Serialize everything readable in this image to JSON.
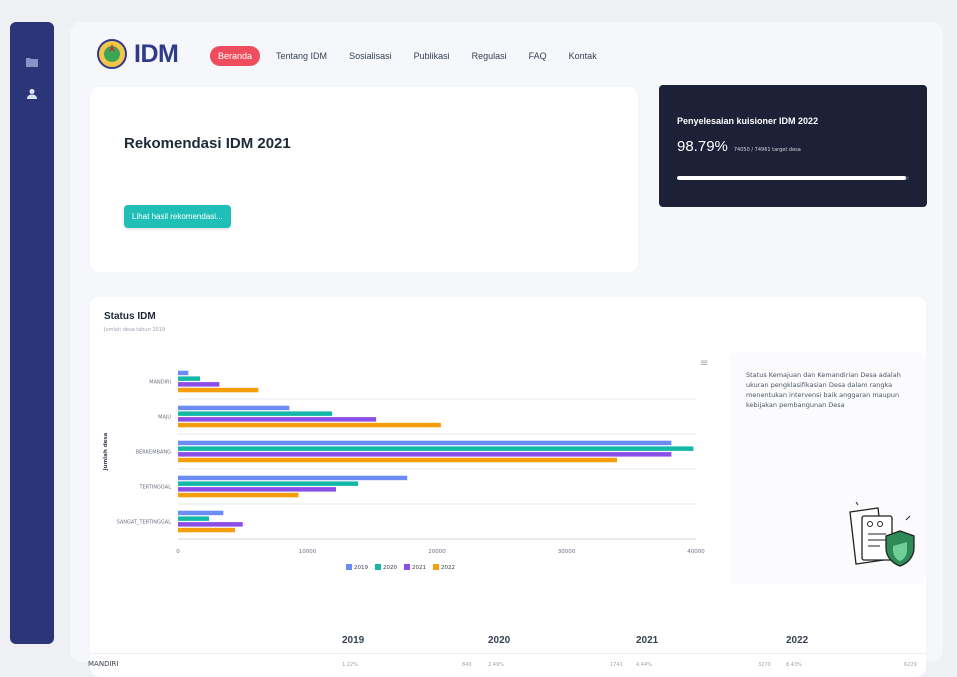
{
  "nav": {
    "logo_text": "IDM",
    "items": [
      "Beranda",
      "Tentang IDM",
      "Sosialisasi",
      "Publikasi",
      "Regulasi",
      "FAQ",
      "Kontak"
    ],
    "active": "Beranda"
  },
  "recommendation": {
    "title": "Rekomendasi IDM 2021",
    "button": "Lihat hasil rekomendasi..."
  },
  "progress": {
    "title": "Penyelesaian kuisioner IDM 2022",
    "percent": "98.79%",
    "detail": "74050 / 74961 target desa",
    "fraction": 0.9879
  },
  "status": {
    "title": "Status IDM",
    "subtitle": "Jumlah desa tahun 2019"
  },
  "info": {
    "text": "Status Kemajuan dan Kemandirian Desa adalah ukuran pengklasifikasian Desa dalam rangka menentukan intervensi baik anggaran maupun kebijakan pembangunan Desa"
  },
  "chart_data": {
    "type": "bar",
    "orientation": "horizontal",
    "categories": [
      "MANDIRI",
      "MAJU",
      "BERKEMBANG",
      "TERTINGGAL",
      "SANGAT_TERTINGGAL"
    ],
    "series": [
      {
        "name": "2019",
        "color": "#6b8cf5",
        "values": [
          800,
          8600,
          38100,
          17700,
          3500
        ]
      },
      {
        "name": "2020",
        "color": "#14b8a6",
        "values": [
          1700,
          11900,
          39800,
          13900,
          2400
        ]
      },
      {
        "name": "2021",
        "color": "#8b4fe8",
        "values": [
          3200,
          15300,
          38100,
          12200,
          5000
        ]
      },
      {
        "name": "2022",
        "color": "#f59e0b",
        "values": [
          6200,
          20300,
          33900,
          9300,
          4400
        ]
      }
    ],
    "xlim": [
      0,
      40000
    ],
    "xticks": [
      "0",
      "10000",
      "20000",
      "30000",
      "40000"
    ],
    "ylabel": "Jumlah desa",
    "legend": "bottom"
  },
  "table": {
    "years": [
      "2019",
      "2020",
      "2021",
      "2022"
    ],
    "row_label": "MANDIRI",
    "cells": [
      "1.22%",
      "840",
      "2.49%",
      "1741",
      "4.44%",
      "3270",
      "8.43%",
      "6229"
    ]
  },
  "colors": {
    "sidebar": "#2c3577",
    "accent": "#ef4d5e",
    "teal": "#1fbfb8",
    "dark": "#1c2137"
  }
}
